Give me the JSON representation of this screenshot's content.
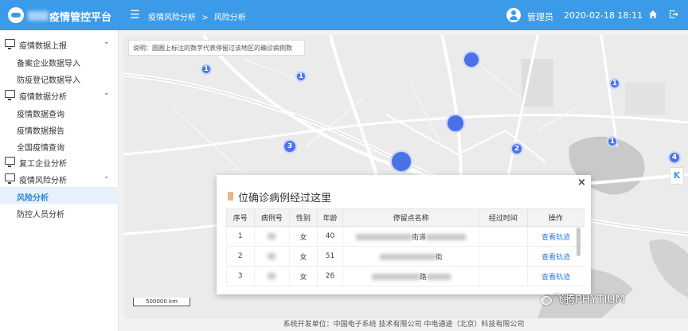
{
  "header": {
    "title": "疫情管控平台",
    "breadcrumb": [
      "疫情风险分析",
      ">",
      "风险分析"
    ],
    "user_name": "管理员",
    "datetime": "2020-02-18 18:11",
    "accent_color": "#3b9be8"
  },
  "sidebar": {
    "groups": [
      {
        "label": "疫情数据上报",
        "items": [
          "备案企业数据导入",
          "防疫登记数据导入"
        ]
      },
      {
        "label": "疫情数据分析",
        "items": [
          "疫情数据查询",
          "疫情数据报告",
          "全国疫情查询"
        ]
      },
      {
        "label": "复工企业分析",
        "items": []
      },
      {
        "label": "疫情风险分析",
        "items": [
          "风险分析",
          "防控人员分析"
        ]
      }
    ],
    "active_item": "风险分析"
  },
  "map": {
    "note": "说明：圆圈上标注的数字代表停留过该地区的确诊病例数",
    "scale_label": "500000 km",
    "markers": [
      "1",
      "1",
      "",
      "1",
      "",
      "3",
      "2",
      "1",
      "",
      "4"
    ],
    "collapse_label": "K"
  },
  "modal": {
    "title": "位确诊病例经过这里",
    "close_label": "×",
    "columns": [
      "序号",
      "病例号",
      "性别",
      "年龄",
      "停留点名称",
      "经过时间",
      "操作"
    ],
    "rows": [
      {
        "index": "1",
        "gender": "女",
        "age": "40",
        "place_suffix": "街道",
        "action": "查看轨迹"
      },
      {
        "index": "2",
        "gender": "女",
        "age": "51",
        "place_suffix": "街",
        "action": "查看轨迹"
      },
      {
        "index": "3",
        "gender": "女",
        "age": "26",
        "place_suffix": "路",
        "action": "查看轨迹"
      }
    ]
  },
  "footer": {
    "text": "系统开发单位：中国电子系统 技术有限公司 中电通途（北京）科技有限公司"
  },
  "watermark": "飞腾PHYTIUM"
}
